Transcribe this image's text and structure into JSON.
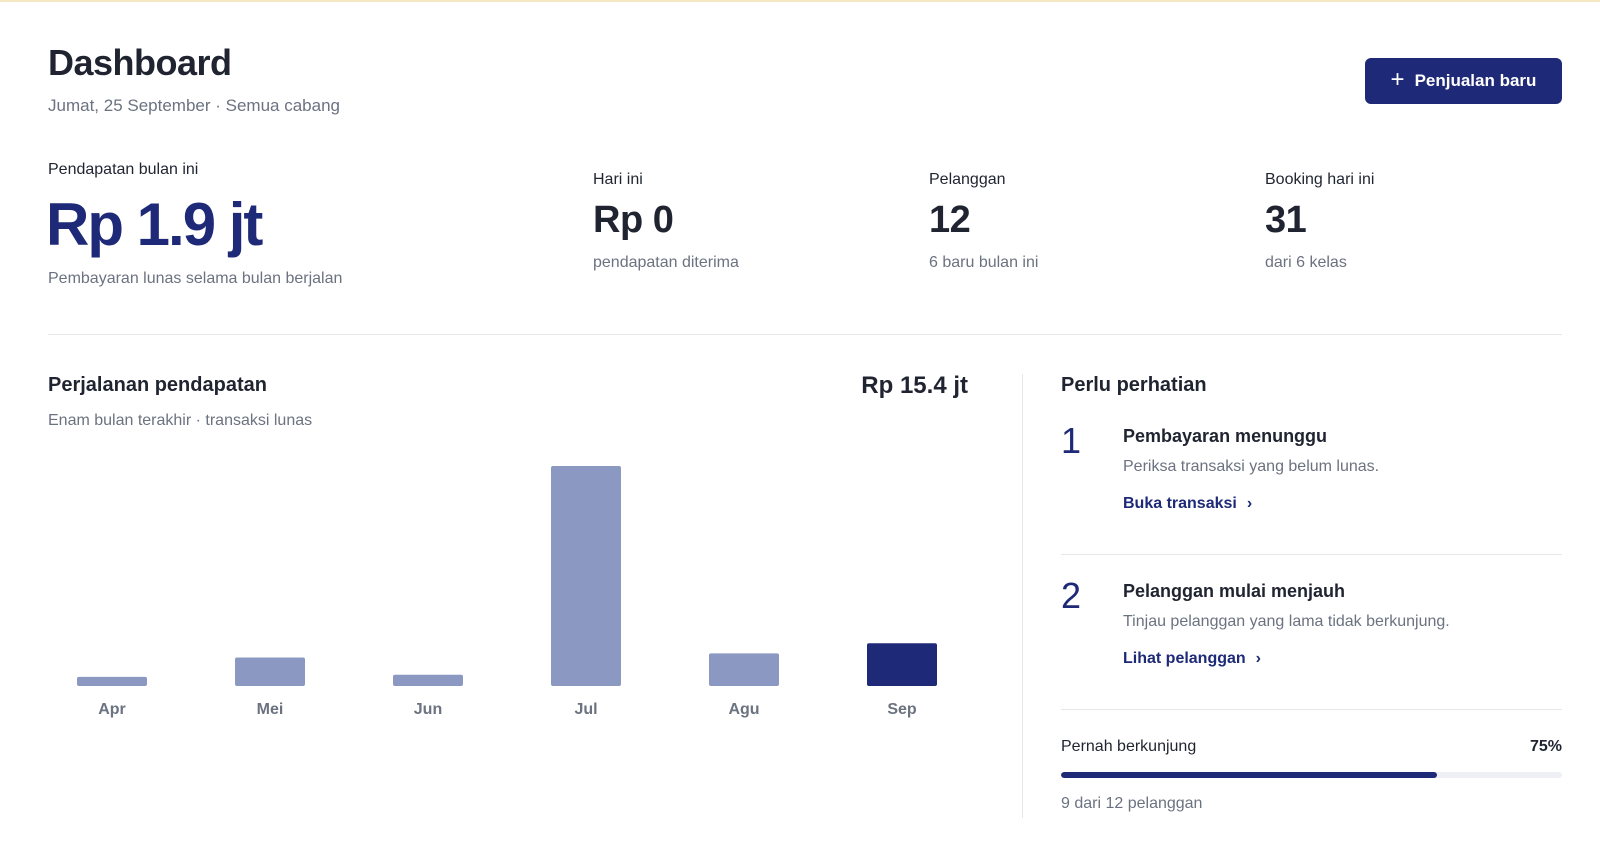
{
  "header": {
    "title": "Dashboard",
    "subtitle": "Jumat, 25 September · Semua cabang",
    "new_sale_label": "Penjualan baru"
  },
  "kpis": {
    "main": {
      "label": "Pendapatan bulan ini",
      "value": "Rp 1.9 jt",
      "sub": "Pembayaran lunas selama bulan berjalan"
    },
    "items": [
      {
        "label": "Hari ini",
        "value": "Rp 0",
        "sub": "pendapatan diterima"
      },
      {
        "label": "Pelanggan",
        "value": "12",
        "sub": "6 baru bulan ini"
      },
      {
        "label": "Booking hari ini",
        "value": "31",
        "sub": "dari 6 kelas"
      }
    ]
  },
  "revenue": {
    "title": "Perjalanan pendapatan",
    "subtitle": "Enam bulan terakhir · transaksi lunas",
    "total": "Rp 15.4 jt"
  },
  "chart_data": {
    "type": "bar",
    "categories": [
      "Apr",
      "Mei",
      "Jun",
      "Jul",
      "Agu",
      "Sep"
    ],
    "values": [
      0.45,
      1.4,
      0.55,
      10.8,
      1.6,
      2.1
    ],
    "ylim": [
      0,
      10.8
    ],
    "highlight_index": 5,
    "grid": false,
    "colors": {
      "bar": "#8b98c1",
      "highlight": "#1e2a78",
      "tick": "#6b7280"
    }
  },
  "attention": {
    "title": "Perlu perhatian",
    "items": [
      {
        "num": "1",
        "title": "Pembayaran menunggu",
        "desc": "Periksa transaksi yang belum lunas.",
        "link": "Buka transaksi"
      },
      {
        "num": "2",
        "title": "Pelanggan mulai menjauh",
        "desc": "Tinjau pelanggan yang lama tidak berkunjung.",
        "link": "Lihat pelanggan"
      }
    ],
    "visits": {
      "label": "Pernah berkunjung",
      "percent_label": "75%",
      "percent": 75,
      "sub": "9 dari 12 pelanggan"
    }
  },
  "icons": {
    "add": "plus-icon",
    "link_arrow": "chevron-right-icon"
  },
  "colors": {
    "accent": "#1e2a78",
    "muted_bar": "#8b98c1",
    "text": "#1f2430",
    "muted_text": "#6b7280"
  }
}
